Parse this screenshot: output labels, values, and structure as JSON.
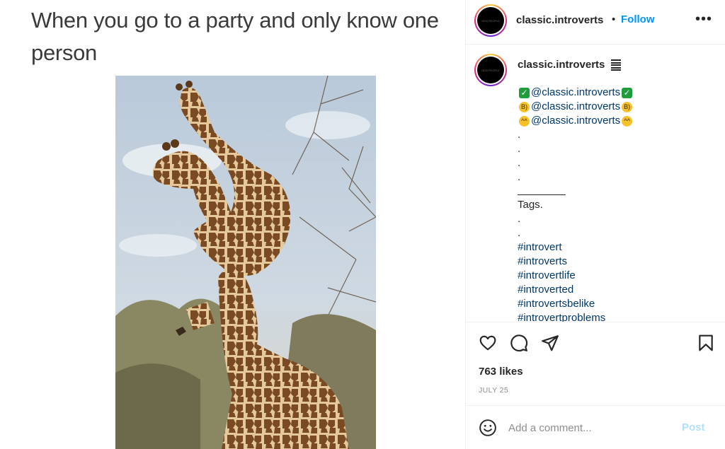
{
  "post": {
    "caption": "When you go to a party and only know one person",
    "photo_icon": "giraffe-photo"
  },
  "header": {
    "username": "classic.introverts",
    "bullet": "•",
    "follow_label": "Follow",
    "more_icon": "more-options-icon",
    "more_label": "•••"
  },
  "comment": {
    "username": "classic.introverts",
    "avatar_text": "GEN PEOPLE",
    "lines": [
      {
        "pre": "✅",
        "mention": "@classic.introverts",
        "post": "✅"
      },
      {
        "pre": "😎",
        "mention": "@classic.introverts",
        "post": "😎"
      },
      {
        "pre": "😅",
        "mention": "@classic.introverts",
        "post": "😅"
      }
    ],
    "dots": [
      ".",
      ".",
      ".",
      "."
    ],
    "tags_label": "Tags.",
    "tag_dots": [
      ".",
      "."
    ],
    "hashtags": [
      "#introvert",
      "#introverts",
      "#introvertlife",
      "#introverted",
      "#introvertsbelike",
      "#introvertproblems"
    ]
  },
  "actions": {
    "like_icon": "heart-icon",
    "comment_icon": "comment-icon",
    "share_icon": "send-icon",
    "save_icon": "bookmark-icon",
    "likes": "763 likes",
    "date": "JULY 25"
  },
  "add_comment": {
    "emoji_icon": "emoji-icon",
    "placeholder": "Add a comment...",
    "post_label": "Post"
  },
  "colors": {
    "link": "#0095f6",
    "mention": "#00376b",
    "post_disabled": "#b2dffc"
  }
}
